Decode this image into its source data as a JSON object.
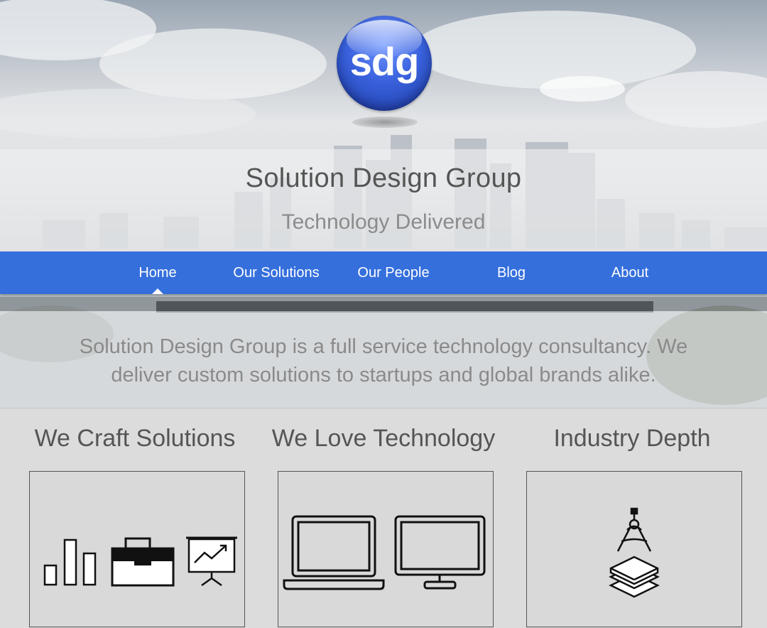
{
  "logo": {
    "text": "sdg"
  },
  "header": {
    "title": "Solution Design Group",
    "tagline": "Technology Delivered"
  },
  "nav": {
    "items": [
      {
        "label": "Home",
        "active": true
      },
      {
        "label": "Our Solutions",
        "active": false
      },
      {
        "label": "Our People",
        "active": false
      },
      {
        "label": "Blog",
        "active": false
      },
      {
        "label": "About",
        "active": false
      }
    ]
  },
  "intro": {
    "text": "Solution Design Group is a full service technology consultancy. We deliver custom solutions to startups and global brands alike."
  },
  "features": [
    {
      "title": "We Craft Solutions",
      "icons": [
        "bar-chart-icon",
        "briefcase-icon",
        "presentation-icon"
      ]
    },
    {
      "title": "We Love Technology",
      "icons": [
        "laptop-icon",
        "desktop-monitor-icon"
      ]
    },
    {
      "title": "Industry Depth",
      "icons": [
        "drafting-compass-icon",
        "layers-icon"
      ]
    }
  ],
  "colors": {
    "nav_bg": "#356fdc",
    "logo_blue": "#2f55d4",
    "title_text": "#555555",
    "tagline_text": "#8c8c8c"
  }
}
